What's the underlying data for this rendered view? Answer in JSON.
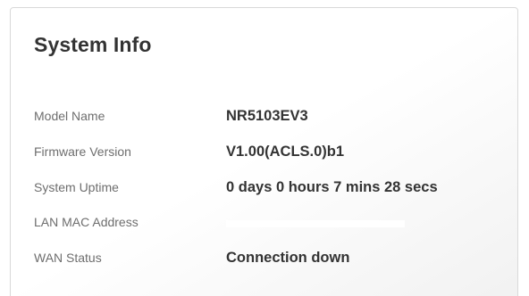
{
  "system_info": {
    "title": "System Info",
    "rows": [
      {
        "label": "Model Name",
        "value": "NR5103EV3"
      },
      {
        "label": "Firmware Version",
        "value": "V1.00(ACLS.0)b1"
      },
      {
        "label": "System Uptime",
        "value": "0 days 0 hours 7 mins 28 secs"
      },
      {
        "label": "LAN MAC Address",
        "value": ""
      },
      {
        "label": "WAN Status",
        "value": "Connection down"
      }
    ]
  },
  "colors": {
    "title": "#333333",
    "label": "#6e6e6e",
    "value": "#333333",
    "card_border": "#d9d9d9"
  }
}
